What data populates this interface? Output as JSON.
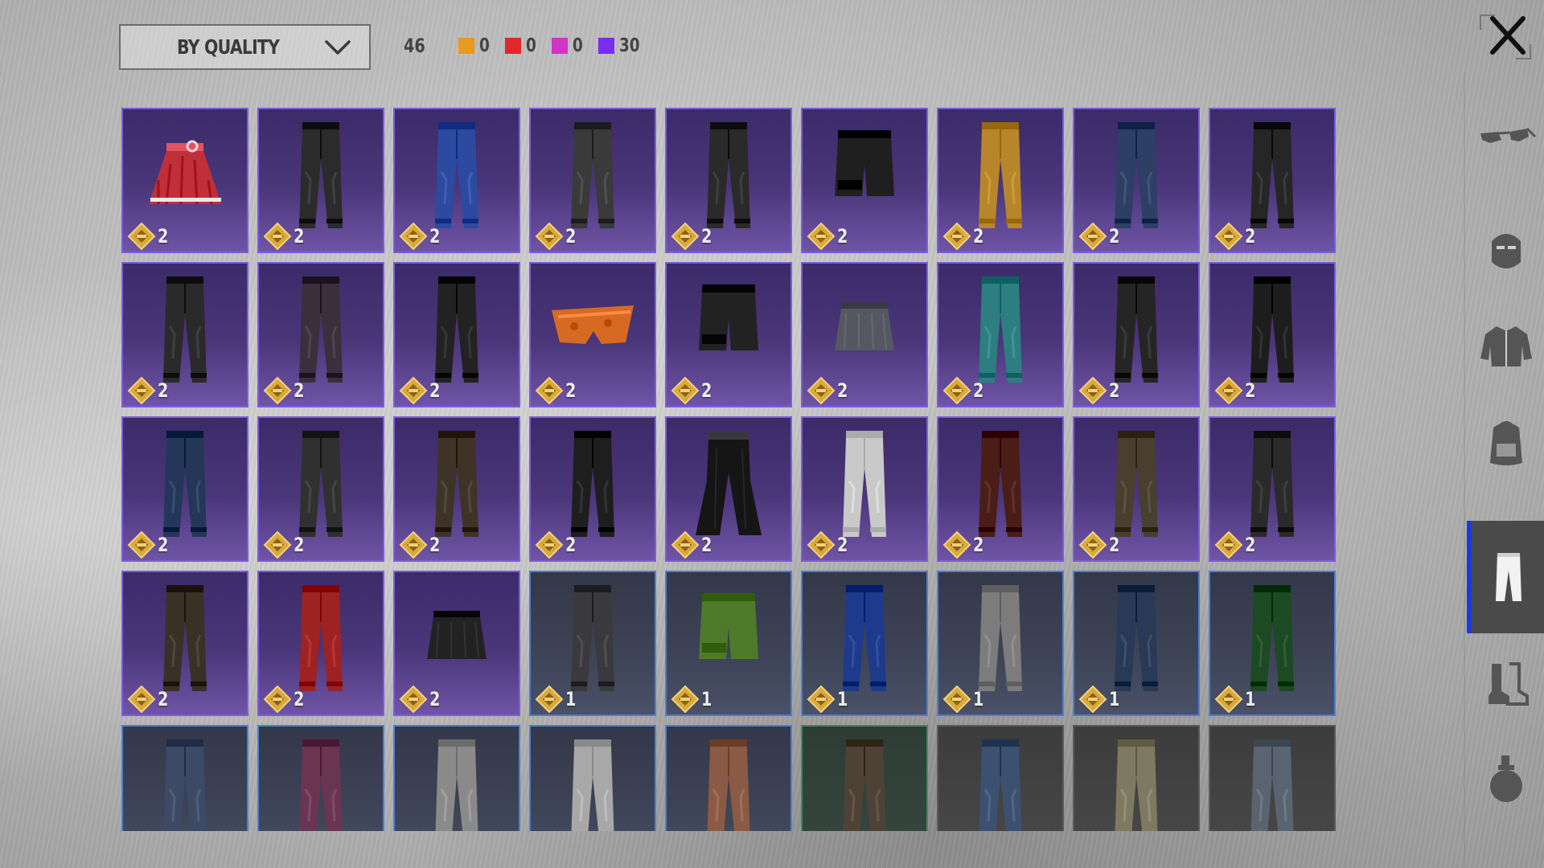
{
  "toolbar": {
    "sort_label": "BY QUALITY",
    "total_count": "46",
    "quality_counts": [
      {
        "color": "#e89a1c",
        "count": "0"
      },
      {
        "color": "#e0282c",
        "count": "0"
      },
      {
        "color": "#d233c8",
        "count": "0"
      },
      {
        "color": "#7a2cf0",
        "count": "30"
      }
    ]
  },
  "sidebar": {
    "tabs": [
      {
        "name": "glasses-icon",
        "active": false
      },
      {
        "name": "mask-icon",
        "active": false
      },
      {
        "name": "jacket-icon",
        "active": false
      },
      {
        "name": "backpack-icon",
        "active": false
      },
      {
        "name": "pants-icon",
        "active": true
      },
      {
        "name": "boots-icon",
        "active": false
      },
      {
        "name": "grenade-icon",
        "active": false
      }
    ]
  },
  "inventory": {
    "items": [
      {
        "type": "skirt",
        "color": "#c0303a",
        "quality": "purple",
        "count": "2"
      },
      {
        "type": "pants",
        "color": "#2b2b2b",
        "quality": "purple",
        "count": "2"
      },
      {
        "type": "pants",
        "color": "#2c4aa0",
        "quality": "purple",
        "count": "2"
      },
      {
        "type": "pants",
        "color": "#3a3a3a",
        "quality": "purple",
        "count": "2"
      },
      {
        "type": "pants",
        "color": "#2a2a2a",
        "quality": "purple",
        "count": "2"
      },
      {
        "type": "shorts",
        "color": "#1f1f1f",
        "quality": "purple",
        "count": "2"
      },
      {
        "type": "pants",
        "color": "#b8862a",
        "quality": "purple",
        "count": "2"
      },
      {
        "type": "pants",
        "color": "#2e3f66",
        "quality": "purple",
        "count": "2"
      },
      {
        "type": "pants",
        "color": "#262626",
        "quality": "purple",
        "count": "2"
      },
      {
        "type": "pants",
        "color": "#2a2a2a",
        "quality": "purple",
        "count": "2"
      },
      {
        "type": "pants",
        "color": "#3a2f3a",
        "quality": "purple",
        "count": "2"
      },
      {
        "type": "pants",
        "color": "#222222",
        "quality": "purple",
        "count": "2"
      },
      {
        "type": "briefs",
        "color": "#d76a22",
        "quality": "purple",
        "count": "2"
      },
      {
        "type": "shorts",
        "color": "#222222",
        "quality": "purple",
        "count": "2"
      },
      {
        "type": "miniskirt",
        "color": "#555860",
        "quality": "purple",
        "count": "2"
      },
      {
        "type": "pants",
        "color": "#2d7e80",
        "quality": "purple",
        "count": "2"
      },
      {
        "type": "pants",
        "color": "#252525",
        "quality": "purple",
        "count": "2"
      },
      {
        "type": "pants",
        "color": "#1d1d1d",
        "quality": "purple",
        "count": "2"
      },
      {
        "type": "pants",
        "color": "#243758",
        "quality": "purple",
        "count": "2"
      },
      {
        "type": "pants",
        "color": "#303030",
        "quality": "purple",
        "count": "2"
      },
      {
        "type": "pants",
        "color": "#3f3328",
        "quality": "purple",
        "count": "2"
      },
      {
        "type": "pants",
        "color": "#1e1e1e",
        "quality": "purple",
        "count": "2"
      },
      {
        "type": "flares",
        "color": "#151515",
        "quality": "purple",
        "count": "2"
      },
      {
        "type": "pants",
        "color": "#c9c9c9",
        "quality": "purple",
        "count": "2"
      },
      {
        "type": "pants",
        "color": "#4a1d17",
        "quality": "purple",
        "count": "2"
      },
      {
        "type": "pants",
        "color": "#4a3e2e",
        "quality": "purple",
        "count": "2"
      },
      {
        "type": "pants",
        "color": "#2a2a2a",
        "quality": "purple",
        "count": "2"
      },
      {
        "type": "pants",
        "color": "#3b3026",
        "quality": "purple",
        "count": "2"
      },
      {
        "type": "pants",
        "color": "#9e2222",
        "quality": "purple",
        "count": "2"
      },
      {
        "type": "miniskirt",
        "color": "#222222",
        "quality": "purple",
        "count": "2"
      },
      {
        "type": "pants",
        "color": "#3a3a3e",
        "quality": "blue",
        "count": "1"
      },
      {
        "type": "shorts",
        "color": "#4e7a2a",
        "quality": "blue",
        "count": "1"
      },
      {
        "type": "pants",
        "color": "#1e3a8a",
        "quality": "blue",
        "count": "1"
      },
      {
        "type": "pants",
        "color": "#7c7c7c",
        "quality": "blue",
        "count": "1"
      },
      {
        "type": "pants",
        "color": "#283a55",
        "quality": "blue",
        "count": "1"
      },
      {
        "type": "pants",
        "color": "#1c4a22",
        "quality": "blue",
        "count": "1"
      },
      {
        "type": "pants",
        "color": "#3c4a66",
        "quality": "blue",
        "count": ""
      },
      {
        "type": "pants",
        "color": "#6a3552",
        "quality": "blue",
        "count": ""
      },
      {
        "type": "pants",
        "color": "#8a8a8a",
        "quality": "blue",
        "count": ""
      },
      {
        "type": "pants",
        "color": "#a8a8a8",
        "quality": "blue",
        "count": ""
      },
      {
        "type": "pants",
        "color": "#8a5a44",
        "quality": "blue",
        "count": ""
      },
      {
        "type": "pants",
        "color": "#4e4236",
        "quality": "green",
        "count": ""
      },
      {
        "type": "pants",
        "color": "#3c5070",
        "quality": "white",
        "count": ""
      },
      {
        "type": "pants",
        "color": "#7e7a62",
        "quality": "white",
        "count": ""
      },
      {
        "type": "pants",
        "color": "#5a6470",
        "quality": "white",
        "count": ""
      }
    ]
  }
}
